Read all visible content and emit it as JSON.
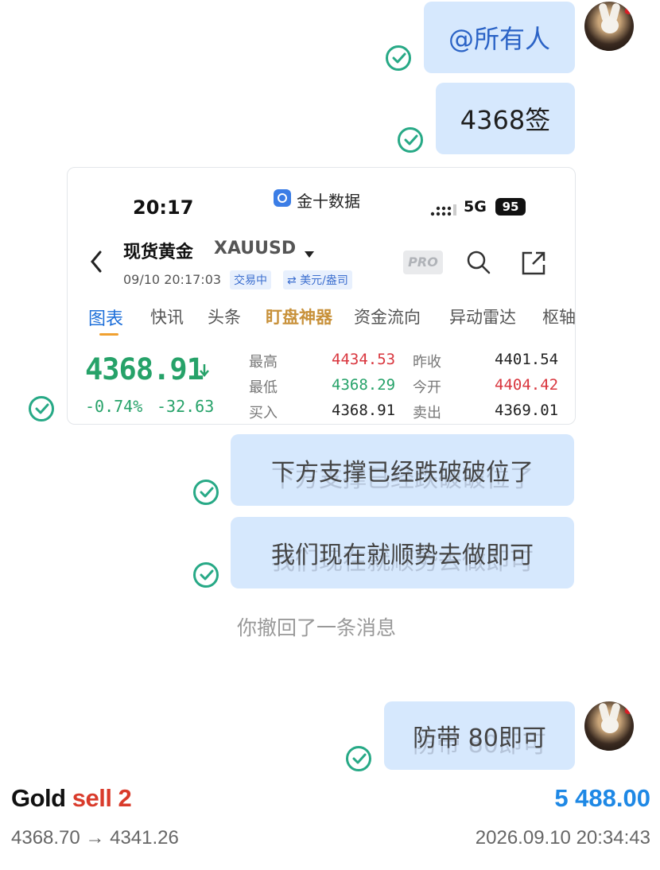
{
  "messages": {
    "mention": "@所有人",
    "entry": "4368签",
    "support_broken": "下方支撑已经跌破破位了",
    "follow_trend": "我们现在就顺势去做即可",
    "recalled_notice": "你撤回了一条消息",
    "stop_loss": "防带 80即可"
  },
  "quote_card": {
    "status_bar": {
      "time": "20:17",
      "app_name": "金十数据",
      "network": "5G",
      "battery": "95"
    },
    "header": {
      "name": "现货黄金",
      "symbol": "XAUUSD",
      "datetime": "09/10 20:17:03",
      "status_badge": "交易中",
      "unit_badge": "⇄ 美元/盎司",
      "pro_label": "PRO"
    },
    "tabs": [
      "图表",
      "快讯",
      "头条",
      "盯盘神器",
      "资金流向",
      "异动雷达",
      "枢轴"
    ],
    "price": "4368.91",
    "change_pct": "-0.74%",
    "change_abs": "-32.63",
    "quotes": {
      "high_label": "最高",
      "high": "4434.53",
      "low_label": "最低",
      "low": "4368.29",
      "buy_label": "买入",
      "buy": "4368.91",
      "prev_close_label": "昨收",
      "prev_close": "4401.54",
      "open_label": "今开",
      "open": "4404.42",
      "sell_label": "卖出",
      "sell": "4369.01"
    },
    "colors": {
      "up": "#d9363e",
      "down": "#26a269",
      "accent": "#1e6fd9"
    }
  },
  "trade": {
    "instrument": "Gold",
    "side": "sell 2",
    "amount": "5 488.00",
    "price_path": "4368.70 → 4341.26",
    "timestamp": "2026.09.10 20:34:43"
  }
}
